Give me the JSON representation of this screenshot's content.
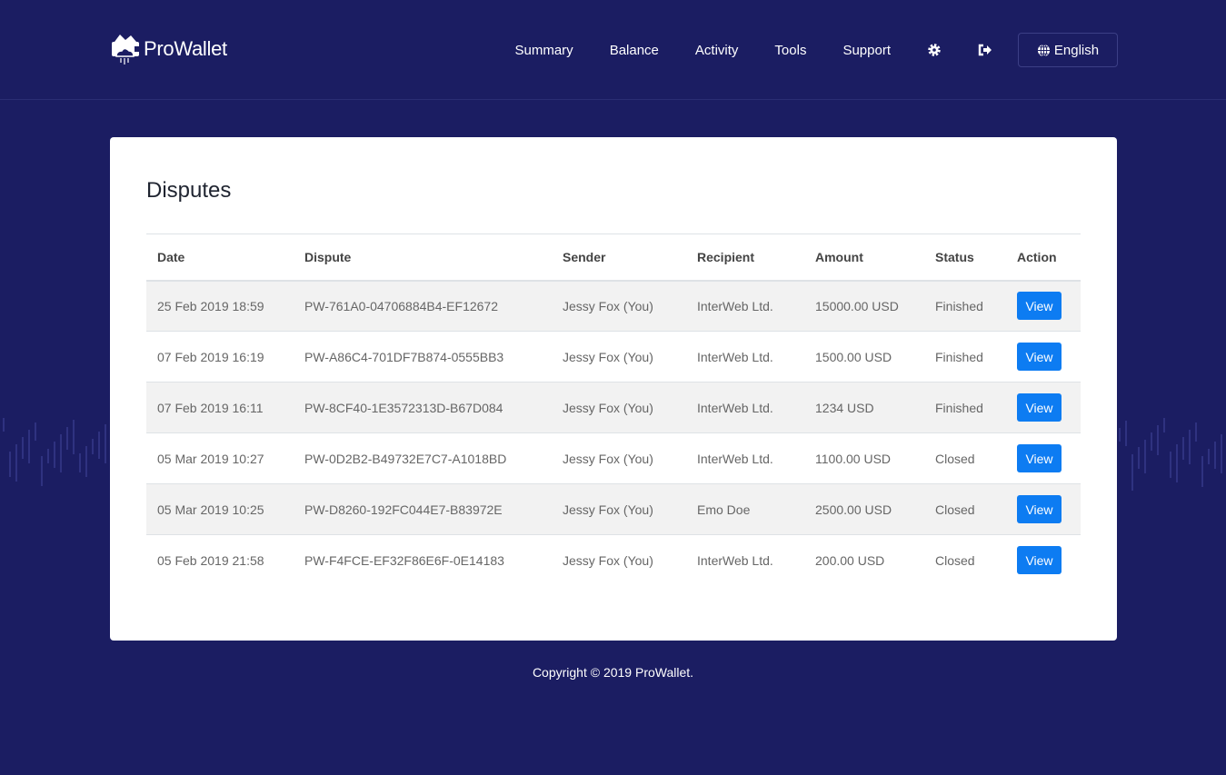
{
  "brand": {
    "name": "ProWallet"
  },
  "nav": {
    "items": [
      "Summary",
      "Balance",
      "Activity",
      "Tools",
      "Support"
    ],
    "language": "English",
    "icons": [
      "gear-icon",
      "sign-out-icon",
      "globe-icon"
    ]
  },
  "page": {
    "title": "Disputes"
  },
  "table": {
    "headers": [
      "Date",
      "Dispute",
      "Sender",
      "Recipient",
      "Amount",
      "Status",
      "Action"
    ],
    "rows": [
      [
        "25 Feb 2019 18:59",
        "PW-761A0-04706884B4-EF12672",
        "Jessy Fox (You)",
        "InterWeb Ltd.",
        "15000.00 USD",
        "Finished",
        "View"
      ],
      [
        "07 Feb 2019 16:19",
        "PW-A86C4-701DF7B874-0555BB3",
        "Jessy Fox (You)",
        "InterWeb Ltd.",
        "1500.00 USD",
        "Finished",
        "View"
      ],
      [
        "07 Feb 2019 16:11",
        "PW-8CF40-1E3572313D-B67D084",
        "Jessy Fox (You)",
        "InterWeb Ltd.",
        "1234 USD",
        "Finished",
        "View"
      ],
      [
        "05 Mar 2019 10:27",
        "PW-0D2B2-B49732E7C7-A1018BD",
        "Jessy Fox (You)",
        "InterWeb Ltd.",
        "1100.00 USD",
        "Closed",
        "View"
      ],
      [
        "05 Mar 2019 10:25",
        "PW-D8260-192FC044E7-B83972E",
        "Jessy Fox (You)",
        "Emo Doe",
        "2500.00 USD",
        "Closed",
        "View"
      ],
      [
        "05 Feb 2019 21:58",
        "PW-F4FCE-EF32F86E6F-0E14183",
        "Jessy Fox (You)",
        "InterWeb Ltd.",
        "200.00 USD",
        "Closed",
        "View"
      ]
    ]
  },
  "footer": {
    "copyright": "Copyright © 2019 ProWallet."
  },
  "colors": {
    "background": "#1b1d62",
    "accent": "#0d7cf2"
  }
}
